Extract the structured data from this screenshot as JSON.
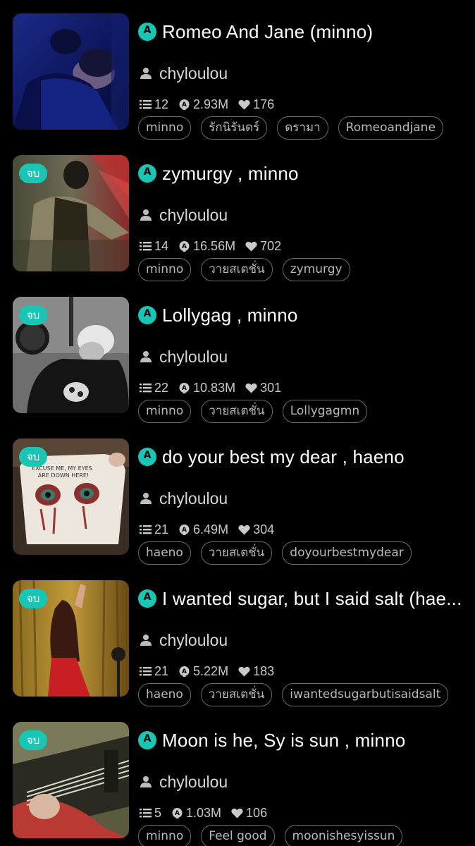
{
  "stories": [
    {
      "title": "Romeo And Jane (minno)",
      "author": "chyloulou",
      "chapters": "12",
      "reads": "2.93M",
      "likes": "176",
      "completed": false,
      "badge": "",
      "tags": [
        "minno",
        "รักนิรันดร์",
        "ดรามา",
        "Romeoandjane"
      ]
    },
    {
      "title": "zymurgy , minno",
      "author": "chyloulou",
      "chapters": "14",
      "reads": "16.56M",
      "likes": "702",
      "completed": true,
      "badge": "จบ",
      "tags": [
        "minno",
        "วายสเตชั่น",
        "zymurgy"
      ]
    },
    {
      "title": "Lollygag , minno",
      "author": "chyloulou",
      "chapters": "22",
      "reads": "10.83M",
      "likes": "301",
      "completed": true,
      "badge": "จบ",
      "tags": [
        "minno",
        "วายสเตชั่น",
        "Lollygagmn"
      ]
    },
    {
      "title": "do your best my dear , haeno",
      "author": "chyloulou",
      "chapters": "21",
      "reads": "6.49M",
      "likes": "304",
      "completed": true,
      "badge": "จบ",
      "tags": [
        "haeno",
        "วายสเตชั่น",
        "doyourbestmydear"
      ]
    },
    {
      "title": "I wanted sugar, but I said salt (hae...",
      "author": "chyloulou",
      "chapters": "21",
      "reads": "5.22M",
      "likes": "183",
      "completed": true,
      "badge": "จบ",
      "tags": [
        "haeno",
        "วายสเตชั่น",
        "iwantedsugarbutisaidsalt"
      ]
    },
    {
      "title": "Moon is he, Sy is sun , minno",
      "author": "chyloulou",
      "chapters": "5",
      "reads": "1.03M",
      "likes": "106",
      "completed": true,
      "badge": "จบ",
      "tags": [
        "minno",
        "Feel good",
        "moonishesyissun"
      ]
    }
  ],
  "colors": {
    "background": "#000000",
    "accent": "#19c6b5",
    "tag_border": "#6a6a6a"
  },
  "icons": {
    "type": "a-badge-icon",
    "author": "user-icon",
    "chapters": "list-icon",
    "reads": "reads-icon",
    "likes": "heart-icon"
  }
}
